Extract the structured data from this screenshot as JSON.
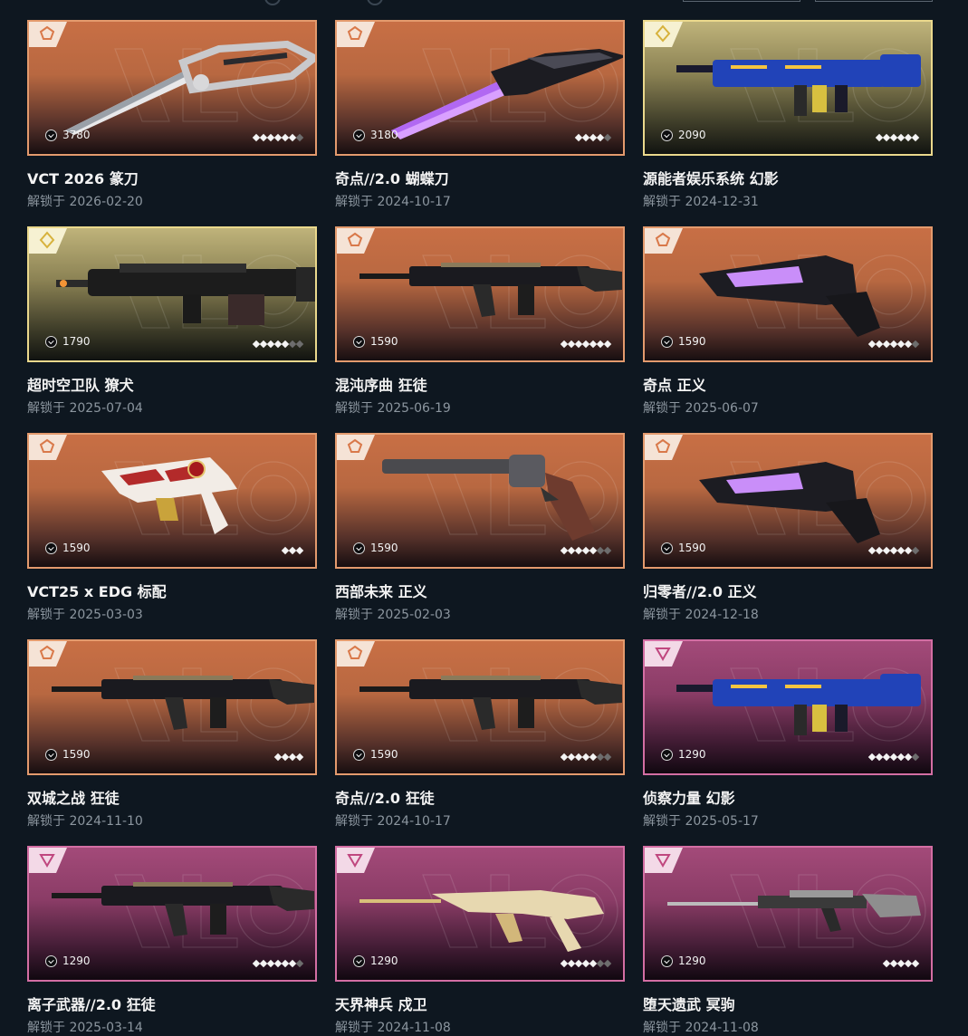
{
  "unlock_prefix": "解锁于",
  "cards": [
    {
      "name": "VCT 2026 篆刀",
      "date": "2026-02-20",
      "price": "3780",
      "tier": "orange",
      "stars": 6,
      "stars_total": 7,
      "weapon": "knife"
    },
    {
      "name": "奇点//2.0 蝴蝶刀",
      "date": "2024-10-17",
      "price": "3180",
      "tier": "orange",
      "stars": 4,
      "stars_total": 5,
      "weapon": "butterfly-knife"
    },
    {
      "name": "源能者娱乐系统 幻影",
      "date": "2024-12-31",
      "price": "2090",
      "tier": "gold",
      "stars": 6,
      "stars_total": 6,
      "weapon": "phantom"
    },
    {
      "name": "超时空卫队 獠犬",
      "date": "2025-07-04",
      "price": "1790",
      "tier": "gold",
      "stars": 5,
      "stars_total": 7,
      "weapon": "bulldog"
    },
    {
      "name": "混沌序曲 狂徒",
      "date": "2025-06-19",
      "price": "1590",
      "tier": "orange",
      "stars": 7,
      "stars_total": 7,
      "weapon": "vandal"
    },
    {
      "name": "奇点 正义",
      "date": "2025-06-07",
      "price": "1590",
      "tier": "orange",
      "stars": 6,
      "stars_total": 7,
      "weapon": "sheriff"
    },
    {
      "name": "VCT25 x EDG 标配",
      "date": "2025-03-03",
      "price": "1590",
      "tier": "orange",
      "stars": 3,
      "stars_total": 3,
      "weapon": "classic"
    },
    {
      "name": "西部未来 正义",
      "date": "2025-02-03",
      "price": "1590",
      "tier": "orange",
      "stars": 5,
      "stars_total": 7,
      "weapon": "revolver"
    },
    {
      "name": "归零者//2.0 正义",
      "date": "2024-12-18",
      "price": "1590",
      "tier": "orange",
      "stars": 6,
      "stars_total": 7,
      "weapon": "sheriff"
    },
    {
      "name": "双城之战 狂徒",
      "date": "2024-11-10",
      "price": "1590",
      "tier": "orange",
      "stars": 4,
      "stars_total": 4,
      "weapon": "vandal"
    },
    {
      "name": "奇点//2.0 狂徒",
      "date": "2024-10-17",
      "price": "1590",
      "tier": "orange",
      "stars": 5,
      "stars_total": 7,
      "weapon": "vandal"
    },
    {
      "name": "侦察力量 幻影",
      "date": "2025-05-17",
      "price": "1290",
      "tier": "pink",
      "stars": 6,
      "stars_total": 7,
      "weapon": "phantom"
    },
    {
      "name": "离子武器//2.0 狂徒",
      "date": "2025-03-14",
      "price": "1290",
      "tier": "pink",
      "stars": 6,
      "stars_total": 7,
      "weapon": "vandal"
    },
    {
      "name": "天界神兵 戍卫",
      "date": "2024-11-08",
      "price": "1290",
      "tier": "pink",
      "stars": 5,
      "stars_total": 7,
      "weapon": "guardian"
    },
    {
      "name": "堕天遗武 冥驹",
      "date": "2024-11-08",
      "price": "1290",
      "tier": "pink",
      "stars": 5,
      "stars_total": 5,
      "weapon": "marshal"
    }
  ],
  "tier_colors": {
    "orange": "#e39a6d",
    "gold": "#ead88c",
    "pink": "#d36ea3"
  }
}
